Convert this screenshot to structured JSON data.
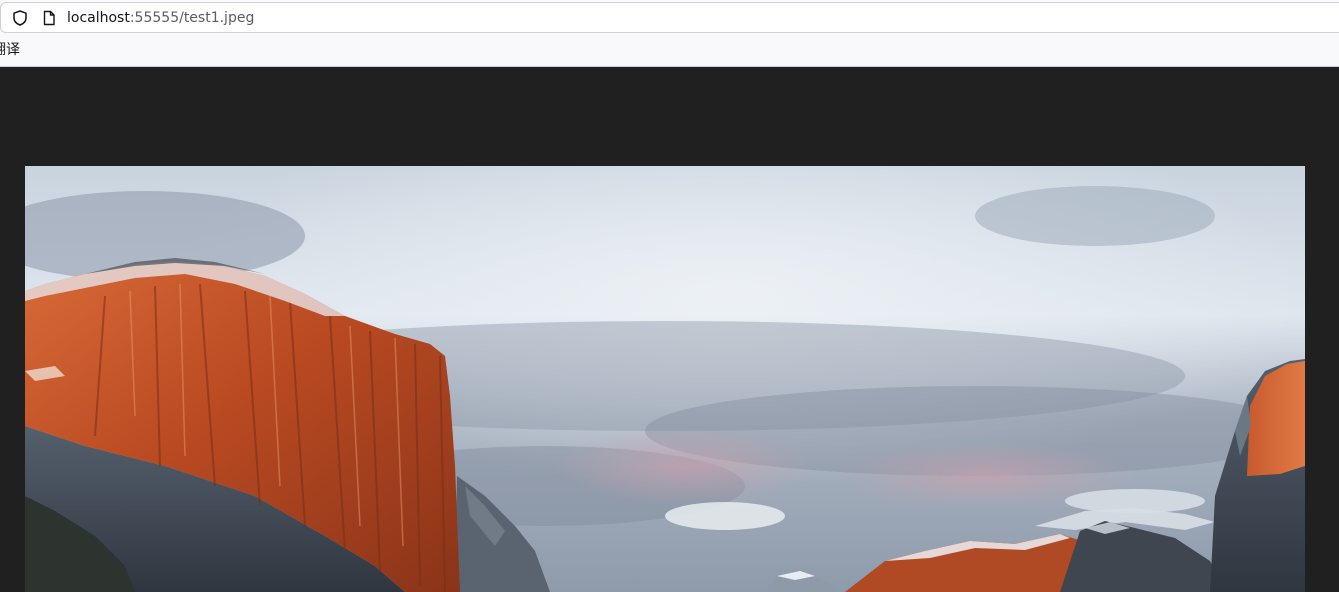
{
  "browser": {
    "url": {
      "host": "localhost",
      "rest": ":55555/test1.jpeg"
    },
    "bookmarks": [
      {
        "label": "翻译"
      }
    ]
  },
  "viewer": {
    "background_color": "#202020",
    "image_description_icon": "photo"
  },
  "colors": {
    "sky_top": "#cfd8e2",
    "cliff_orange": "#c9552a",
    "rock_gray": "#5c6672"
  }
}
